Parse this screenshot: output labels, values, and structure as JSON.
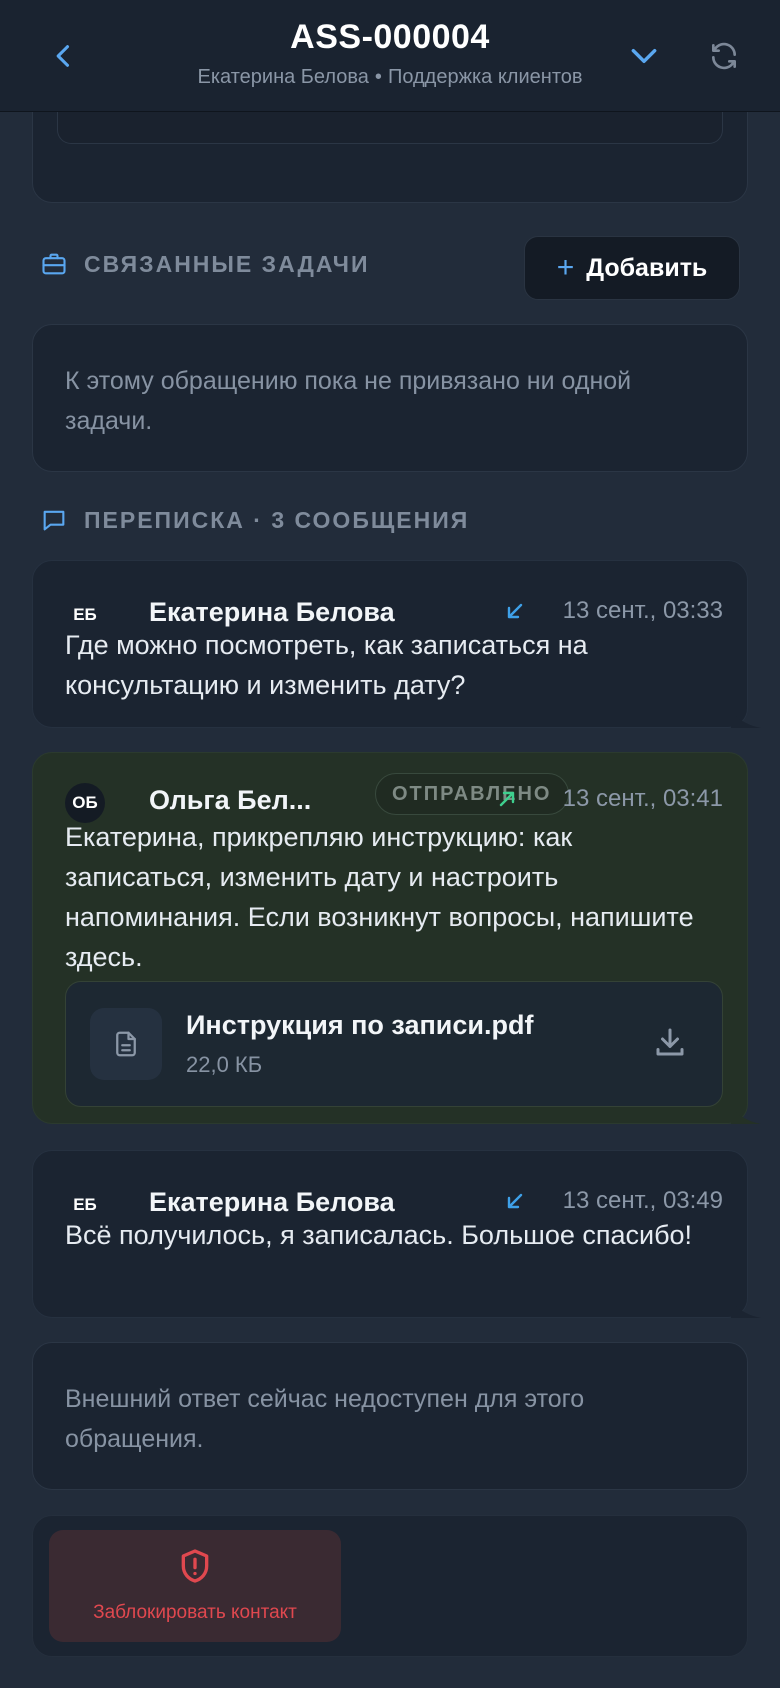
{
  "header": {
    "title": "ASS-000004",
    "contact_name": "Екатерина Белова",
    "separator": "•",
    "team": "Поддержка клиентов"
  },
  "related_tasks": {
    "heading": "СВЯЗАННЫЕ ЗАДАЧИ",
    "add_label": "Добавить",
    "empty_text": "К этому обращению пока не привязано ни одной задачи."
  },
  "conversation": {
    "heading": "ПЕРЕПИСКА · 3 СООБЩЕНИЯ",
    "messages": [
      {
        "initials": "ЕБ",
        "sender": "Екатерина Белова",
        "direction": "incoming",
        "time": "13 сент., 03:33",
        "text": "Где можно посмотреть, как записаться на консультацию и изменить дату?"
      },
      {
        "initials": "ОБ",
        "sender": "Ольга Бел...",
        "status": "ОТПРАВЛЕНО",
        "direction": "outgoing",
        "time": "13 сент., 03:41",
        "text": "Екатерина, прикрепляю инструкцию: как записаться, изменить дату и настроить напоминания. Если возникнут вопросы, напишите здесь.",
        "attachment": {
          "name": "Инструкция по записи.pdf",
          "size": "22,0 КБ"
        }
      },
      {
        "initials": "ЕБ",
        "sender": "Екатерина Белова",
        "direction": "incoming",
        "time": "13 сент., 03:49",
        "text": "Всё получилось, я записалась. Большое спасибо!"
      }
    ]
  },
  "reply_notice": "Внешний ответ сейчас недоступен для этого обращения.",
  "block_contact": {
    "label": "Заблокировать контакт"
  },
  "colors": {
    "accent": "#5aa7f0",
    "incoming_arrow": "#3ea0e8",
    "outgoing_arrow": "#3ecf8e",
    "danger": "#e0484f"
  },
  "icons": {
    "back": "chevron-left-icon",
    "expand": "chevron-down-icon",
    "refresh": "refresh-icon",
    "tasks": "briefcase-icon",
    "conversation": "chat-bubble-icon",
    "file": "document-icon",
    "download": "download-icon",
    "block": "shield-alert-icon"
  }
}
